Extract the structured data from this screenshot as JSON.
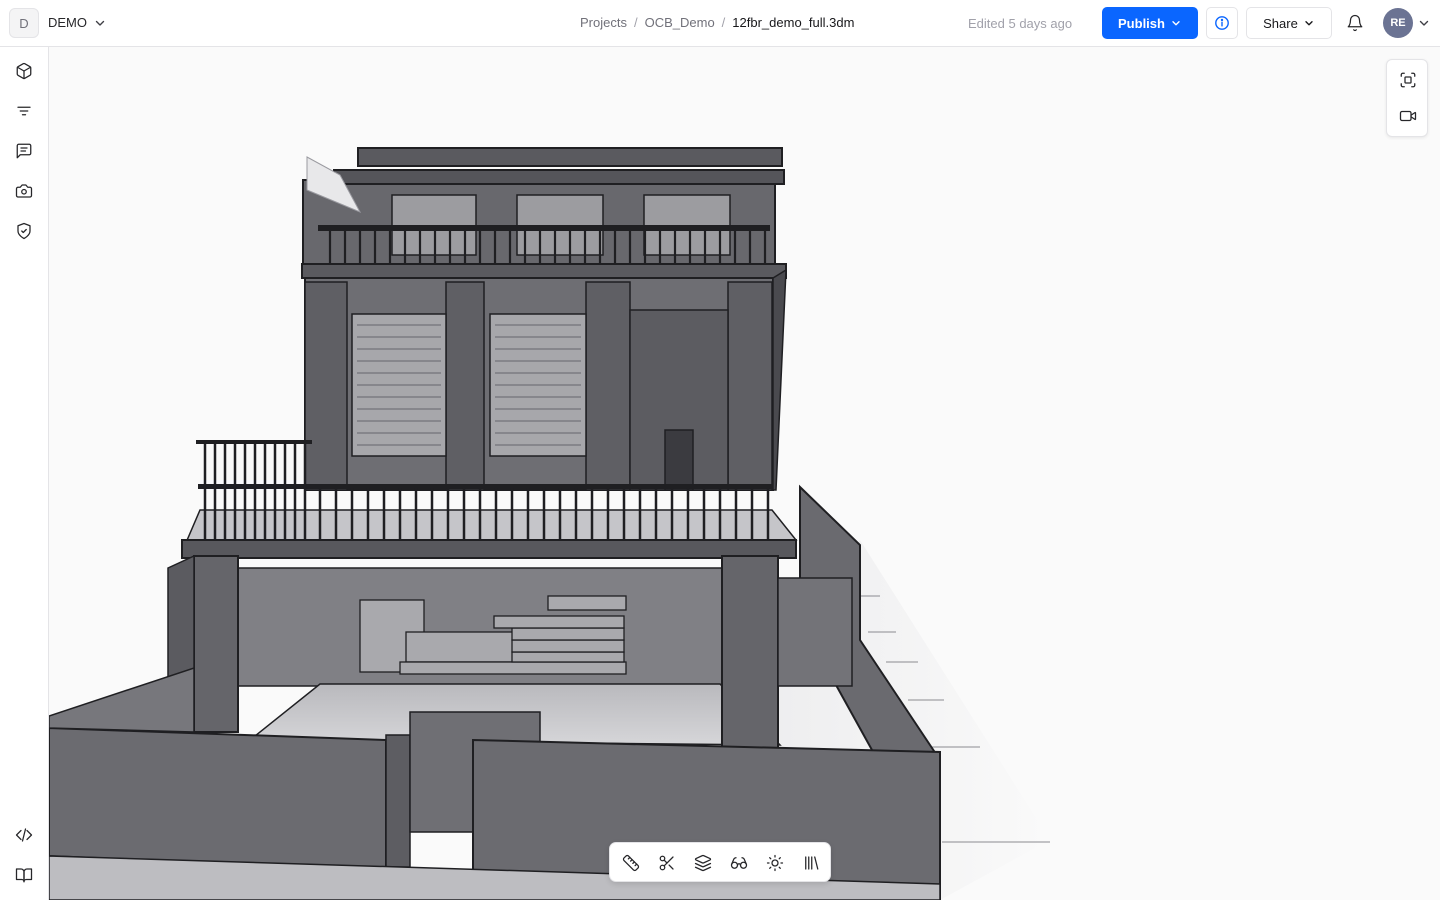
{
  "workspace": {
    "initial": "D",
    "name": "DEMO"
  },
  "breadcrumb": {
    "projects": "Projects",
    "project": "OCB_Demo",
    "file": "12fbr_demo_full.3dm",
    "separator": "/"
  },
  "status": {
    "edited": "Edited 5 days ago"
  },
  "header": {
    "publish_label": "Publish",
    "share_label": "Share"
  },
  "user": {
    "initials": "RE"
  },
  "icons": {
    "sidebar": [
      "cube-icon",
      "filter-icon",
      "comments-icon",
      "camera-icon",
      "shield-check-icon",
      "code-icon",
      "book-icon"
    ],
    "view_controls": [
      "focus-frame-icon",
      "video-camera-icon"
    ],
    "toolbar": [
      "ruler-icon",
      "scissors-icon",
      "layers-icon",
      "glasses-icon",
      "sun-icon",
      "library-icon"
    ]
  },
  "colors": {
    "accent": "#0a66ff",
    "avatar": "#6b7393",
    "model_wall": "#6e6e73",
    "model_dark": "#3f3f44"
  }
}
